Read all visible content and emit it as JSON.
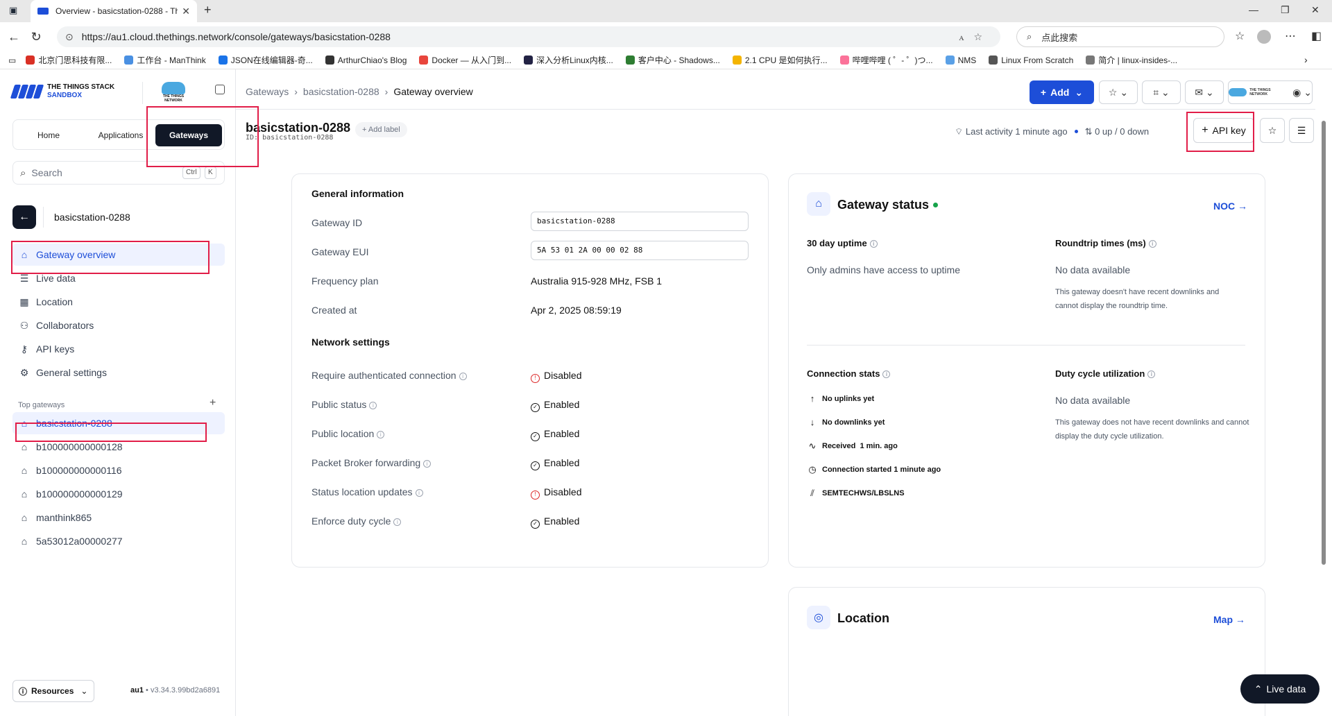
{
  "browser": {
    "tab_title": "Overview - basicstation-0288 - Th",
    "url": "https://au1.cloud.thethings.network/console/gateways/basicstation-0288",
    "search_placeholder": "点此搜索",
    "bookmarks": [
      {
        "label": "北京门思科技有限...",
        "color": "#d93025"
      },
      {
        "label": "工作台 - ManThink",
        "color": "#4a90e2"
      },
      {
        "label": "JSON在线编辑器-奇...",
        "color": "#1a73e8"
      },
      {
        "label": "ArthurChiao's Blog",
        "color": "#333333"
      },
      {
        "label": "Docker — 从入门到...",
        "color": "#e8453c"
      },
      {
        "label": "深入分析Linux内核...",
        "color": "#222244"
      },
      {
        "label": "客户中心 - Shadows...",
        "color": "#2e7d32"
      },
      {
        "label": "2.1 CPU 是如何执行...",
        "color": "#f4b400"
      },
      {
        "label": "哔哩哔哩 ( ゜- ゜)つ...",
        "color": "#fb7299"
      },
      {
        "label": "NMS",
        "color": "#5aa0e6"
      },
      {
        "label": "Linux From Scratch",
        "color": "#555555"
      },
      {
        "label": "简介 | linux-insides-...",
        "color": "#777777"
      }
    ]
  },
  "logo": {
    "line1": "THE THINGS STACK",
    "line2": "SANDBOX",
    "ttn": "THE THINGS NETWORK"
  },
  "segment": {
    "home": "Home",
    "applications": "Applications",
    "gateways": "Gateways"
  },
  "side_search": {
    "placeholder": "Search",
    "kbd1": "Ctrl",
    "kbd2": "K"
  },
  "entity_name": "basicstation-0288",
  "nav": {
    "overview": "Gateway overview",
    "live": "Live data",
    "location": "Location",
    "collaborators": "Collaborators",
    "api_keys": "API keys",
    "settings": "General settings"
  },
  "top_gateways": {
    "heading": "Top gateways",
    "items": [
      "basicstation-0288",
      "b100000000000128",
      "b100000000000116",
      "b100000000000129",
      "manthink865",
      "5a53012a00000277"
    ]
  },
  "footer": {
    "resources": "Resources",
    "region": "au1",
    "version": "v3.34.3.99bd2a6891"
  },
  "breadcrumb": {
    "a": "Gateways",
    "b": "basicstation-0288",
    "c": "Gateway overview"
  },
  "top_actions": {
    "add": "Add"
  },
  "header": {
    "title": "basicstation-0288",
    "id_line": "ID: basicstation-0288",
    "add_label": "Add label",
    "last_activity": "Last activity 1 minute ago",
    "traffic": "0 up / 0 down",
    "api_key": "API key"
  },
  "general": {
    "heading": "General information",
    "gateway_id_label": "Gateway ID",
    "gateway_id": "basicstation-0288",
    "gateway_eui_label": "Gateway EUI",
    "gateway_eui": "5A 53 01 2A 00 00 02 88",
    "freq_label": "Frequency plan",
    "freq": "Australia 915-928 MHz, FSB 1",
    "created_label": "Created at",
    "created": "Apr 2, 2025 08:59:19",
    "network_heading": "Network settings",
    "settings": [
      {
        "label": "Require authenticated connection",
        "value": "Disabled"
      },
      {
        "label": "Public status",
        "value": "Enabled"
      },
      {
        "label": "Public location",
        "value": "Enabled"
      },
      {
        "label": "Packet Broker forwarding",
        "value": "Enabled"
      },
      {
        "label": "Status location updates",
        "value": "Disabled"
      },
      {
        "label": "Enforce duty cycle",
        "value": "Enabled"
      }
    ]
  },
  "status": {
    "title": "Gateway status",
    "noc": "NOC →",
    "uptime_h": "30 day uptime",
    "uptime_txt": "Only admins have access to uptime",
    "rt_h": "Roundtrip times (ms)",
    "rt_txt": "No data available",
    "rt_note": "This gateway doesn't have recent downlinks and cannot display the roundtrip time.",
    "conn_h": "Connection stats",
    "uplinks": "No uplinks yet",
    "downlinks": "No downlinks yet",
    "received": "Received",
    "received_when": "1 min. ago",
    "conn_started": "Connection started 1 minute ago",
    "protocol": "SEMTECHWS/LBSLNS",
    "duty_h": "Duty cycle utilization",
    "duty_txt": "No data available",
    "duty_note": "This gateway does not have recent downlinks and cannot display the duty cycle utilization."
  },
  "location": {
    "title": "Location",
    "map": "Map →"
  },
  "live_data": "Live data",
  "colors": {
    "accent": "#1d4ed8",
    "dark": "#111827",
    "highlight": "#e11d48",
    "disabled": "#dc2626",
    "online": "#16a34a"
  }
}
